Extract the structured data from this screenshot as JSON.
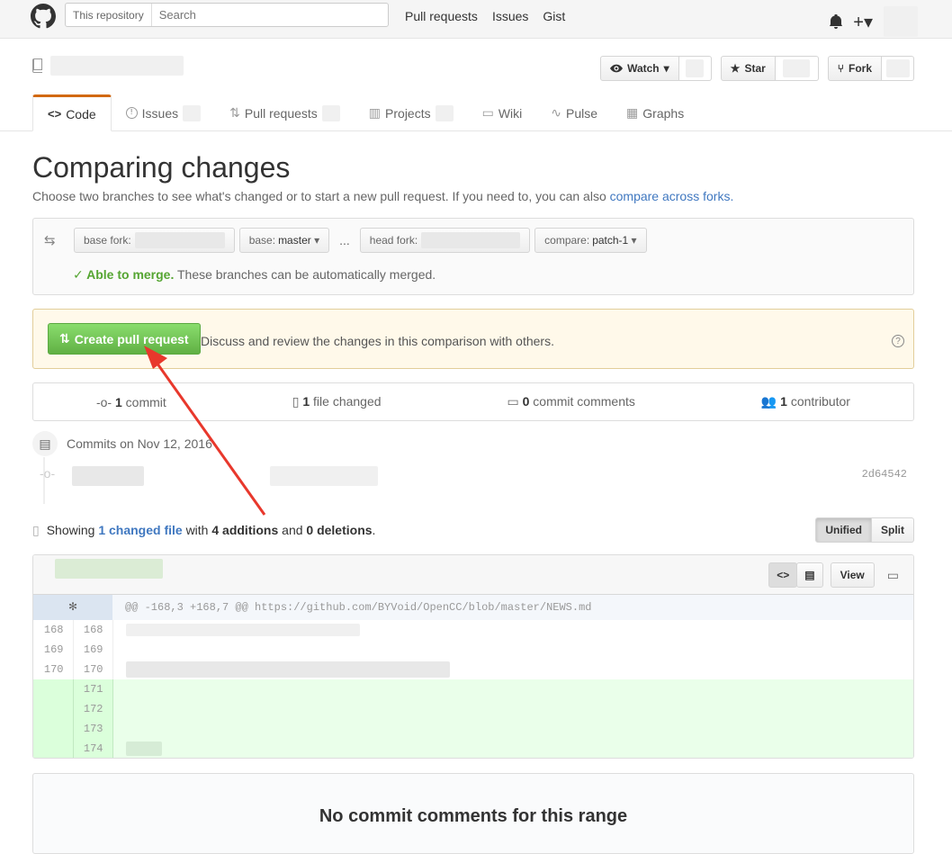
{
  "header": {
    "search_scope": "This repository",
    "search_placeholder": "Search",
    "nav": [
      "Pull requests",
      "Issues",
      "Gist"
    ]
  },
  "repo": {
    "watch_label": "Watch",
    "star_label": "Star",
    "fork_label": "Fork"
  },
  "tabs": [
    "Code",
    "Issues",
    "Pull requests",
    "Projects",
    "Wiki",
    "Pulse",
    "Graphs"
  ],
  "page": {
    "title": "Comparing changes",
    "description": "Choose two branches to see what's changed or to start a new pull request. If you need to, you can also",
    "description_link": "compare across forks."
  },
  "range": {
    "base_fork_label": "base fork:",
    "base_label": "base:",
    "base_value": "master",
    "ellipsis": "...",
    "head_fork_label": "head fork:",
    "compare_label": "compare:",
    "compare_value": "patch-1",
    "merge_status": "Able to merge.",
    "merge_note": "These branches can be automatically merged."
  },
  "pr": {
    "button": "Create pull request",
    "hint": "Discuss and review the changes in this comparison with others."
  },
  "summary": {
    "commits": "1",
    "commits_label": "commit",
    "files": "1",
    "files_label": "file changed",
    "comments": "0",
    "comments_label": "commit comments",
    "contributors": "1",
    "contributors_label": "contributor"
  },
  "commits": {
    "heading": "Commits on Nov 12, 2016",
    "sha": "2d64542"
  },
  "toc": {
    "showing": "Showing",
    "changed": "1 changed file",
    "with": "with",
    "additions": "4 additions",
    "and": "and",
    "deletions": "0 deletions",
    "period": ".",
    "unified": "Unified",
    "split": "Split"
  },
  "diff": {
    "view_label": "View",
    "hunk": "@@ -168,3 +168,7 @@ https://github.com/BYVoid/OpenCC/blob/master/NEWS.md",
    "context_rows": [
      [
        "168",
        "168"
      ],
      [
        "169",
        "169"
      ],
      [
        "170",
        "170"
      ]
    ],
    "added_rows": [
      "171",
      "172",
      "173",
      "174"
    ]
  },
  "comments": {
    "heading": "No commit comments for this range"
  },
  "colors": {
    "accent_tab": "#d26911",
    "link": "#4078c0",
    "success": "#55a532",
    "annotation_arrow": "#e8382c"
  }
}
